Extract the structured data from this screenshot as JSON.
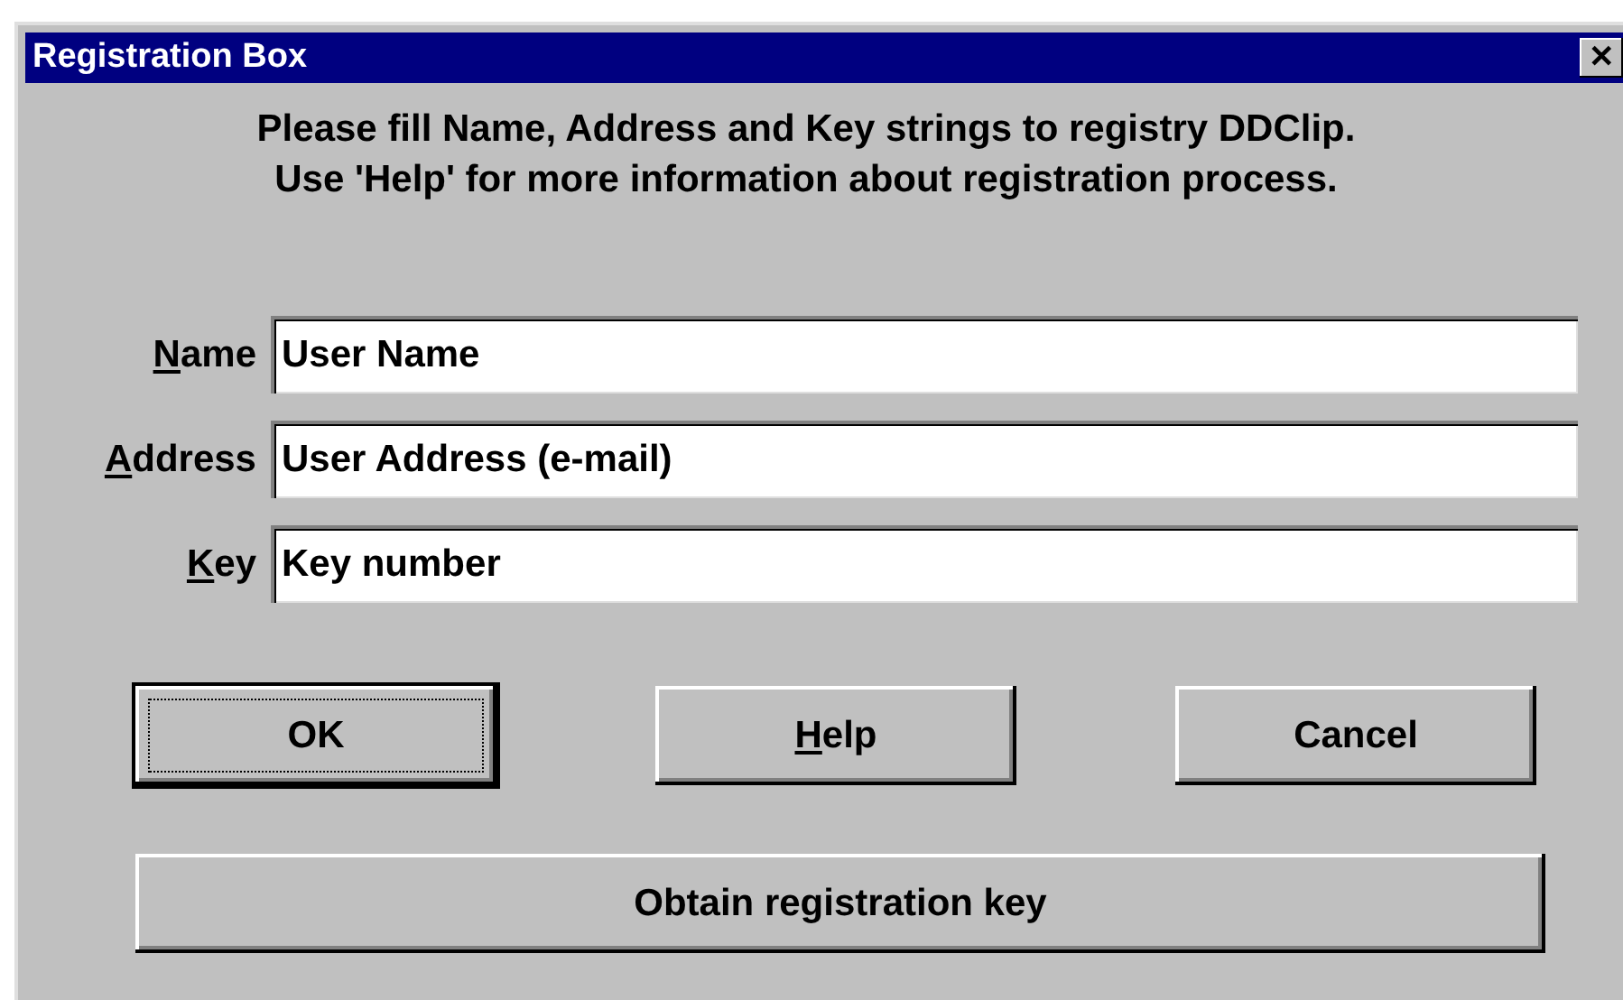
{
  "window": {
    "title": "Registration Box",
    "close": "✕"
  },
  "message": [
    "Please fill Name, Address and Key strings to registry DDClip.",
    "Use 'Help' for more information about registration process."
  ],
  "fields": [
    {
      "label": "Name",
      "underline_first": true,
      "value": "User Name"
    },
    {
      "label": "Address",
      "underline_first": true,
      "value": "User Address (e-mail)"
    },
    {
      "label": "Key",
      "underline_first": true,
      "value": "Key number"
    }
  ],
  "buttons": [
    {
      "label": "OK",
      "underline_first": false,
      "default": true,
      "focused": true
    },
    {
      "label": "Help",
      "underline_first": true,
      "default": false,
      "focused": false
    },
    {
      "label": "Cancel",
      "underline_first": false,
      "default": false,
      "focused": false
    }
  ],
  "wide_button": {
    "label": "Obtain registration key",
    "underline_first": false,
    "default": false,
    "focused": false
  }
}
